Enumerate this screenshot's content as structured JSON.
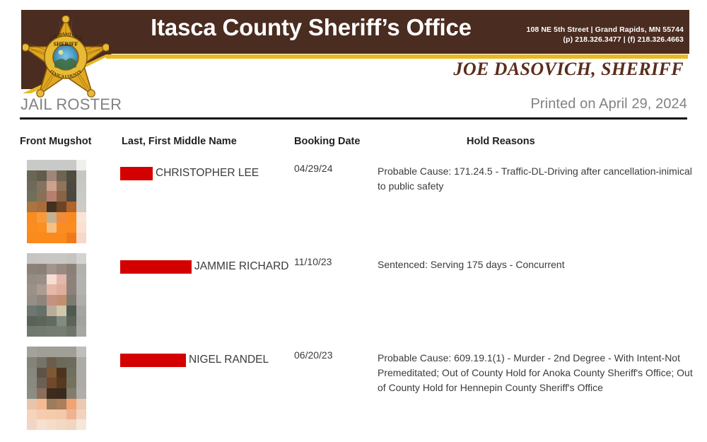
{
  "header": {
    "agency_title": "Itasca County Sheriff’s Office",
    "address_line": "108 NE 5th Street | Grand Rapids, MN 55744",
    "phone_line": "(p) 218.326.3477 | (f) 218.326.4663",
    "sheriff_name": "JOE DASOVICH, SHERIFF",
    "badge": {
      "icon": "sheriff-star-badge-icon",
      "top_text": "JOE DASOVICH",
      "mid_text": "SHERIFF",
      "bottom_text": "ITASCA COUNTY"
    },
    "colors": {
      "banner_brown": "#4a2c20",
      "accent_gold": "#e8b923",
      "sheriff_name_brown": "#5a2d1c",
      "subheader_gray": "#808285",
      "redaction_red": "#d40000"
    }
  },
  "subheader": {
    "roster_title": "JAIL ROSTER",
    "printed_on": "Printed on April 29, 2024"
  },
  "table": {
    "columns": [
      "Front Mugshot",
      "Last, First Middle Name",
      "Booking Date",
      "Hold Reasons"
    ],
    "rows": [
      {
        "mugshot_alt": "pixelated-mugshot-orange-jumpsuit",
        "redacted_last_name_width": 46,
        "name": "CHRISTOPHER LEE",
        "booking_date": "04/29/24",
        "hold_reasons": "Probable Cause: 171.24.5 - Traffic-DL-Driving after cancellation-inimical to public safety",
        "mug_pixels": [
          "#c9c9c7",
          "#c9c9c7",
          "#c9c9c7",
          "#c9c9c7",
          "#c9c9c7",
          "#efefed",
          "#6b6557",
          "#615c4c",
          "#a08579",
          "#6e6452",
          "#4f4c3f",
          "#c5c5c1",
          "#6d6a59",
          "#85735f",
          "#cda18b",
          "#91735a",
          "#4c4a3e",
          "#c7c7c3",
          "#6f7059",
          "#897057",
          "#b6806e",
          "#8a6246",
          "#4a483c",
          "#c9c9c5",
          "#ab7441",
          "#a96c3c",
          "#43301f",
          "#6d4426",
          "#b0632a",
          "#cfcac2",
          "#f98b21",
          "#f99a36",
          "#c4b192",
          "#f08b3c",
          "#fb8a1e",
          "#fae4d6",
          "#fb8d1f",
          "#fb8f20",
          "#f5c081",
          "#fb8d20",
          "#fb8c1f",
          "#fbdfd0",
          "#fb8a1d",
          "#fb8a1d",
          "#fb8a1d",
          "#fb8a1d",
          "#f2791a",
          "#f6d8c8"
        ]
      },
      {
        "mugshot_alt": "pixelated-mugshot-gray-background",
        "redacted_last_name_width": 101,
        "name": "JAMMIE RICHARD",
        "booking_date": "11/10/23",
        "hold_reasons": "Sentenced: Serving 175 days - Concurrent",
        "mug_pixels": [
          "#c6c4c1",
          "#c8c6c3",
          "#c9c7c4",
          "#c9c7c4",
          "#c6c4c1",
          "#d5d3d0",
          "#8d8279",
          "#8b8077",
          "#a2958c",
          "#968a81",
          "#8b8077",
          "#b3b1ae",
          "#958c83",
          "#9a8f86",
          "#f5ddd3",
          "#e3b7ab",
          "#8d8279",
          "#b5b3b0",
          "#9a9188",
          "#ac9c92",
          "#e6b8a8",
          "#e0ae9c",
          "#8d827a",
          "#b4b2af",
          "#978e85",
          "#8e857c",
          "#c49182",
          "#c2906f",
          "#7d7a6f",
          "#b0aeab",
          "#6d7670",
          "#66706b",
          "#b9ac98",
          "#d2c6ab",
          "#4f5a52",
          "#a7a5a2",
          "#5a6258",
          "#5d655b",
          "#636a60",
          "#818b80",
          "#5c6459",
          "#a4a29f",
          "#717870",
          "#73796f",
          "#767c72",
          "#777d73",
          "#6e746a",
          "#a8a6a3"
        ]
      },
      {
        "mugshot_alt": "pixelated-mugshot-light-background",
        "redacted_last_name_width": 93,
        "name": "NIGEL RANDEL",
        "booking_date": "06/20/23",
        "hold_reasons": "Probable Cause: 609.19.1(1) - Murder - 2nd Degree - With Intent-Not Premeditated; Out of County Hold for Anoka County Sheriff's Office; Out of County Hold for Hennepin County Sheriff's Office",
        "mug_pixels": [
          "#a4a29a",
          "#a09e96",
          "#a09e96",
          "#a09e96",
          "#a09e96",
          "#c0beb8",
          "#84837a",
          "#75736a",
          "#6b5c4b",
          "#6b6a58",
          "#6d6b5e",
          "#adaba5",
          "#88877e",
          "#5c5449",
          "#7e5735",
          "#4c3520",
          "#716f62",
          "#adaba5",
          "#8a8980",
          "#6a6055",
          "#71492a",
          "#57391f",
          "#74725f",
          "#adaba5",
          "#8d8c83",
          "#8a6e5b",
          "#3d2c1c",
          "#3a2a1b",
          "#837c6b",
          "#b0aea8",
          "#e8c4ac",
          "#f4ba94",
          "#9b7c5c",
          "#a9805a",
          "#f1a376",
          "#ecc9b2",
          "#f6d4bc",
          "#f7cbae",
          "#f5cbab",
          "#f3c9a9",
          "#f0b391",
          "#f1d4c0",
          "#f2d6c5",
          "#f6e0d0",
          "#f5dcc9",
          "#f3d8c4",
          "#f2d5c0",
          "#f7e6da"
        ]
      }
    ]
  }
}
